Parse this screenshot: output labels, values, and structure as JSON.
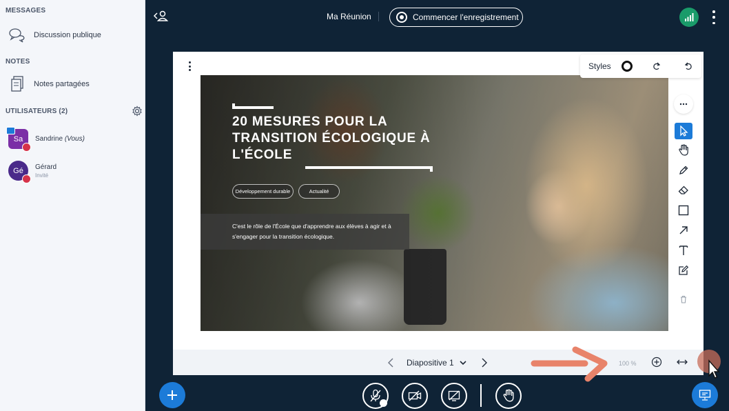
{
  "sidebar": {
    "messages_title": "MESSAGES",
    "public_chat": "Discussion publique",
    "notes_title": "NOTES",
    "shared_notes": "Notes partagées",
    "users_title": "UTILISATEURS (2)",
    "users": [
      {
        "initials": "Sa",
        "name": "Sandrine",
        "suffix": "(Vous)",
        "role": "",
        "color": "#7b2fa6"
      },
      {
        "initials": "Gé",
        "name": "Gérard",
        "suffix": "",
        "role": "Invité",
        "color": "#4a2a8a"
      }
    ]
  },
  "header": {
    "meeting_title": "Ma Réunion",
    "record_label": "Commencer l'enregistrement"
  },
  "presentation": {
    "styles_label": "Styles",
    "slide": {
      "title": "20 mesures pour la transition écologique à l'École",
      "tags": [
        "Développement durable",
        "Actualité"
      ],
      "description": "C'est le rôle de l'École que d'apprendre aux élèves à agir et à s'engager pour la transition écologique."
    },
    "slide_label": "Diapositive 1",
    "zoom": "100 %"
  },
  "colors": {
    "accent": "#1c7bd8",
    "dark_bg": "#0f2336",
    "recording_ok": "#1a9b6a",
    "muted_red": "#d6334a",
    "annotation_arrow": "#e8836a"
  }
}
